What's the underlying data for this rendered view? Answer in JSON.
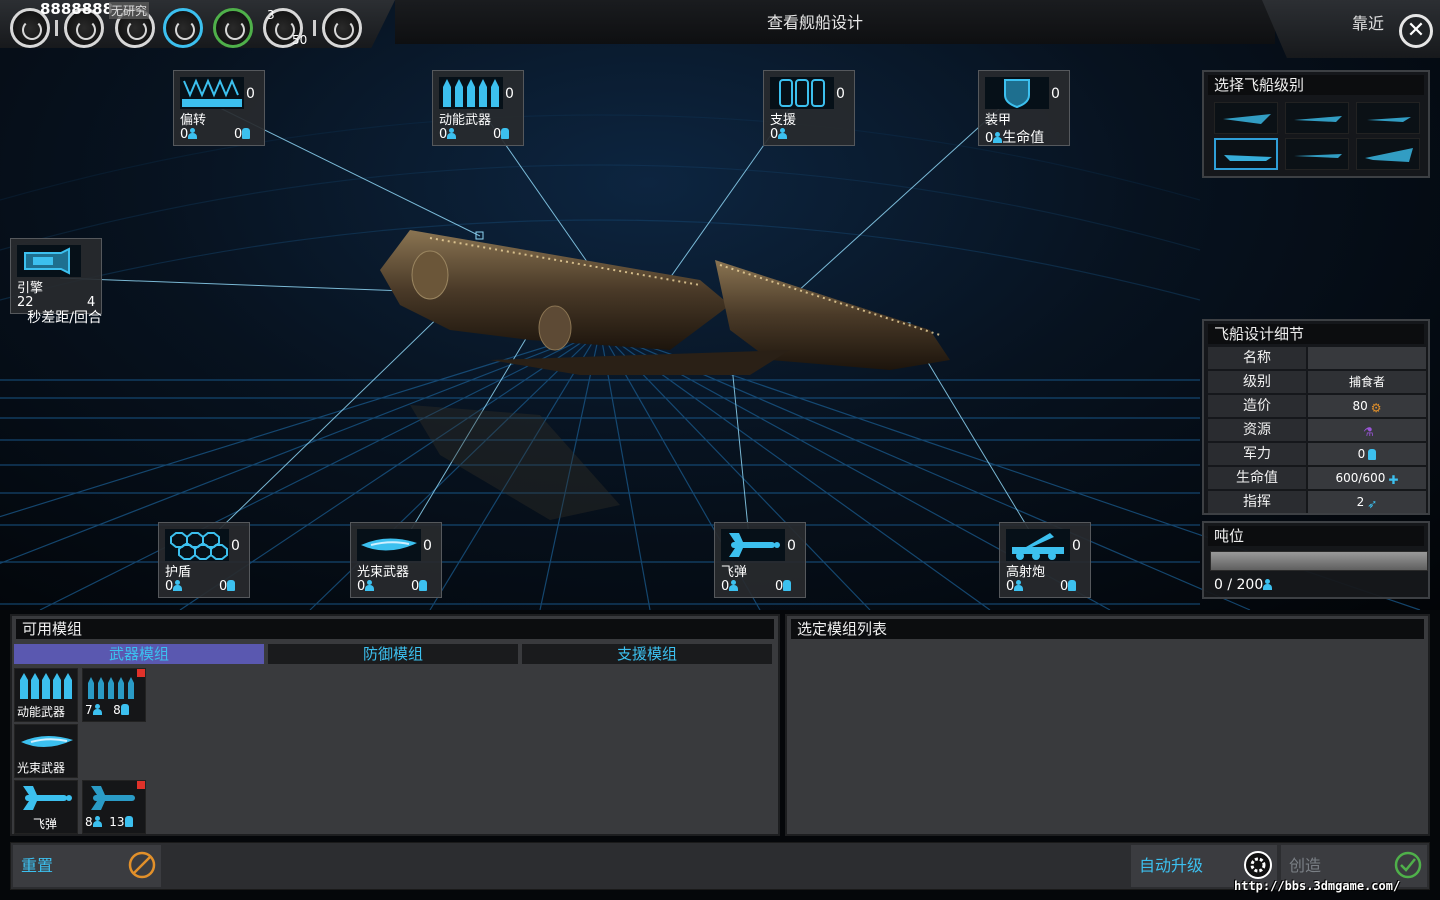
{
  "topbar": {
    "money": "8888888",
    "research": "无研究",
    "pop_small": "3",
    "pop_big": "50",
    "title": "查看舰船设计",
    "zoom_label": "靠近",
    "close_icon": "close-icon"
  },
  "slots": {
    "deflector": {
      "count": "0",
      "name": "偏转",
      "crew": "0",
      "power": "0"
    },
    "kinetic": {
      "count": "0",
      "name": "动能武器",
      "crew": "0",
      "power": "0"
    },
    "support": {
      "count": "0",
      "name": "支援",
      "crew": "0"
    },
    "armor": {
      "count": "0",
      "name": "装甲",
      "crew": "0",
      "hp_label": "生命值"
    },
    "engine": {
      "name": "引擎",
      "value_a": "22",
      "value_b": "4",
      "unit": "秒差距/回合"
    },
    "shield": {
      "count": "0",
      "name": "护盾",
      "crew": "0",
      "power": "0"
    },
    "beam": {
      "count": "0",
      "name": "光束武器",
      "crew": "0",
      "power": "0"
    },
    "missile": {
      "count": "0",
      "name": "飞弹",
      "crew": "0",
      "power": "0"
    },
    "artillery": {
      "count": "0",
      "name": "高射炮",
      "crew": "0",
      "power": "0"
    }
  },
  "class_panel": {
    "title": "选择飞船级别",
    "selected_index": 3
  },
  "design_panel": {
    "title": "飞船设计细节",
    "rows": [
      {
        "label": "名称",
        "value": ""
      },
      {
        "label": "级别",
        "value": "捕食者"
      },
      {
        "label": "造价",
        "value": "80"
      },
      {
        "label": "资源",
        "value": ""
      },
      {
        "label": "军力",
        "value": "0"
      },
      {
        "label": "生命值",
        "value": "600/600"
      },
      {
        "label": "指挥",
        "value": "2"
      }
    ]
  },
  "tonnage": {
    "title": "吨位",
    "text": "0 / 200",
    "used": 0,
    "max": 200
  },
  "modules_panel": {
    "title": "可用模组",
    "tabs": [
      "武器模组",
      "防御模组",
      "支援模组"
    ],
    "active_tab": 0,
    "modules": [
      {
        "name": "动能武器"
      },
      {
        "crew": "7",
        "power": "8"
      },
      {
        "name": "光束武器"
      },
      {
        "name": "飞弹"
      },
      {
        "crew": "8",
        "power": "13"
      }
    ]
  },
  "selected_panel": {
    "title": "选定模组列表"
  },
  "footer": {
    "reset": "重置",
    "auto_upgrade": "自动升级",
    "create": "创造",
    "watermark": "http://bbs.3dmgame.com/"
  },
  "colors": {
    "accent": "#3cc0ef",
    "tab_active": "#5a58b0",
    "reset": "#e2902a",
    "create": "#4fb04a"
  }
}
